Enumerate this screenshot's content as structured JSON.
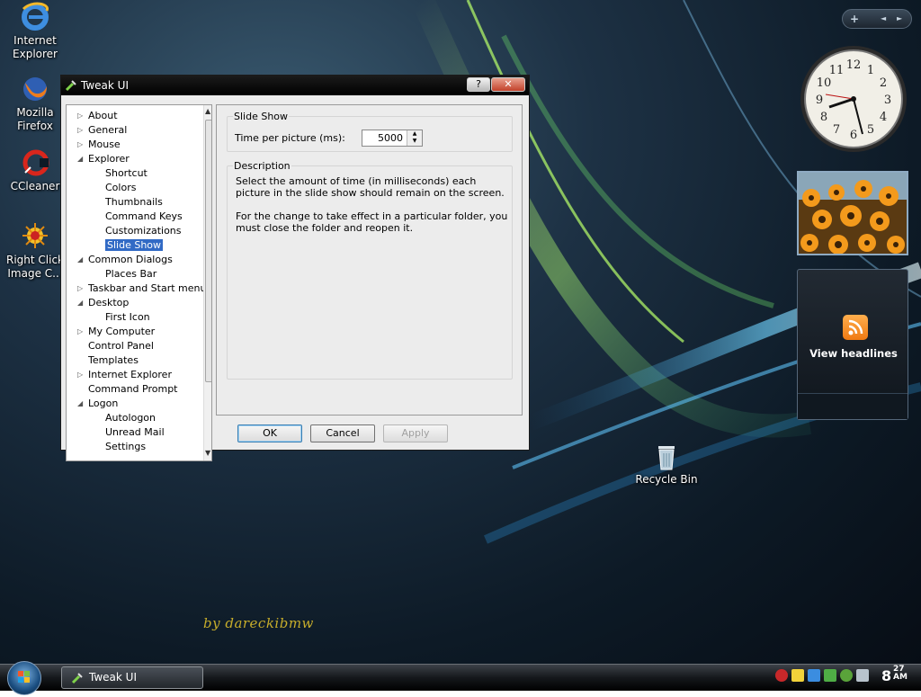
{
  "desktop": {
    "icons": [
      {
        "name": "ie-icon",
        "label": "Internet Explorer"
      },
      {
        "name": "firefox-icon",
        "label": "Mozilla Firefox"
      },
      {
        "name": "ccleaner-icon",
        "label": "CCleaner"
      },
      {
        "name": "right-click-icon",
        "label": "Right Click Image C..."
      },
      {
        "name": "recycle-bin-icon",
        "label": "Recycle Bin"
      }
    ],
    "watermark": "by dareckibmw"
  },
  "gadgets": {
    "sidebar_controls": {
      "add": "+",
      "prev": "◄",
      "next": "►"
    },
    "clock_numbers": [
      "12",
      "1",
      "2",
      "3",
      "4",
      "5",
      "6",
      "7",
      "8",
      "9",
      "10",
      "11"
    ],
    "feed_label": "View headlines"
  },
  "window": {
    "title": "Tweak UI",
    "help_btn": "?",
    "close_btn": "✕",
    "tree": [
      {
        "label": "About",
        "level": 0,
        "exp": "▷"
      },
      {
        "label": "General",
        "level": 0,
        "exp": "▷"
      },
      {
        "label": "Mouse",
        "level": 0,
        "exp": "▷"
      },
      {
        "label": "Explorer",
        "level": 0,
        "exp": "◢"
      },
      {
        "label": "Shortcut",
        "level": 1,
        "exp": ""
      },
      {
        "label": "Colors",
        "level": 1,
        "exp": ""
      },
      {
        "label": "Thumbnails",
        "level": 1,
        "exp": ""
      },
      {
        "label": "Command Keys",
        "level": 1,
        "exp": ""
      },
      {
        "label": "Customizations",
        "level": 1,
        "exp": ""
      },
      {
        "label": "Slide Show",
        "level": 1,
        "exp": "",
        "selected": true
      },
      {
        "label": "Common Dialogs",
        "level": 0,
        "exp": "◢"
      },
      {
        "label": "Places Bar",
        "level": 1,
        "exp": ""
      },
      {
        "label": "Taskbar and Start menu",
        "level": 0,
        "exp": "▷"
      },
      {
        "label": "Desktop",
        "level": 0,
        "exp": "◢"
      },
      {
        "label": "First Icon",
        "level": 1,
        "exp": ""
      },
      {
        "label": "My Computer",
        "level": 0,
        "exp": "▷"
      },
      {
        "label": "Control Panel",
        "level": 0,
        "exp": ""
      },
      {
        "label": "Templates",
        "level": 0,
        "exp": ""
      },
      {
        "label": "Internet Explorer",
        "level": 0,
        "exp": "▷"
      },
      {
        "label": "Command Prompt",
        "level": 0,
        "exp": ""
      },
      {
        "label": "Logon",
        "level": 0,
        "exp": "◢"
      },
      {
        "label": "Autologon",
        "level": 1,
        "exp": ""
      },
      {
        "label": "Unread Mail",
        "level": 1,
        "exp": ""
      },
      {
        "label": "Settings",
        "level": 1,
        "exp": ""
      }
    ],
    "slideshow": {
      "group_title": "Slide Show",
      "time_label": "Time per picture (ms):",
      "time_value": "5000"
    },
    "description": {
      "group_title": "Description",
      "para1": "Select the amount of time (in milliseconds) each picture in the slide show should remain on the screen.",
      "para2": "For the change to take effect in a particular folder, you must close the folder and reopen it."
    },
    "buttons": {
      "ok": "OK",
      "cancel": "Cancel",
      "apply": "Apply"
    }
  },
  "taskbar": {
    "task_label": "Tweak UI",
    "clock_hour": "8",
    "clock_minute": "27",
    "clock_ampm": "AM"
  }
}
